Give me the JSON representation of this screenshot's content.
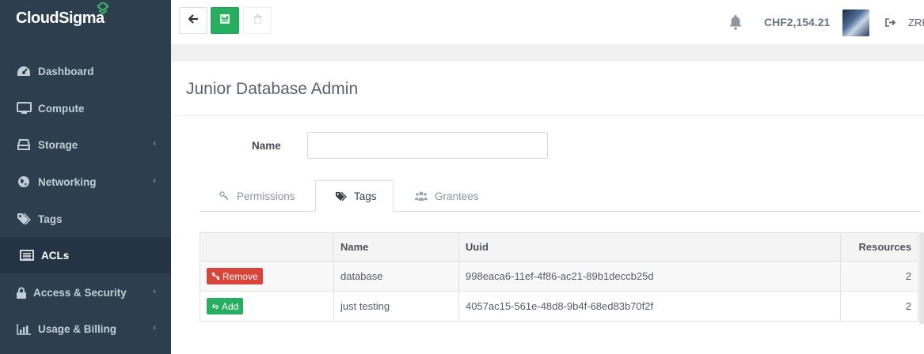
{
  "brand": {
    "name": "CloudSigma",
    "accent": "#27ae60",
    "sidebar_bg": "#2d3e4f"
  },
  "sidebar": {
    "items": [
      {
        "label": "Dashboard",
        "icon": "dashboard-icon",
        "has_submenu": false
      },
      {
        "label": "Compute",
        "icon": "monitor-icon",
        "has_submenu": false
      },
      {
        "label": "Storage",
        "icon": "hdd-icon",
        "has_submenu": true
      },
      {
        "label": "Networking",
        "icon": "globe-icon",
        "has_submenu": true
      },
      {
        "label": "Tags",
        "icon": "tags-icon",
        "has_submenu": false
      },
      {
        "label": "ACLs",
        "icon": "list-icon",
        "has_submenu": false,
        "active": true
      },
      {
        "label": "Access & Security",
        "icon": "lock-icon",
        "has_submenu": true
      },
      {
        "label": "Usage & Billing",
        "icon": "bar-chart-icon",
        "has_submenu": true
      }
    ]
  },
  "topbar": {
    "balance": "CHF2,154.21",
    "region": "ZRH",
    "icons": [
      "back-arrow-icon",
      "save-icon",
      "trash-icon",
      "bell-icon",
      "logout-icon"
    ]
  },
  "page": {
    "title": "Junior Database Admin",
    "name_label": "Name",
    "name_value": ""
  },
  "tabs": [
    {
      "label": "Permissions",
      "icon": "key-icon",
      "active": false
    },
    {
      "label": "Tags",
      "icon": "tags-icon",
      "active": true
    },
    {
      "label": "Grantees",
      "icon": "users-icon",
      "active": false
    }
  ],
  "table": {
    "headers": [
      "",
      "Name",
      "Uuid",
      "Resources"
    ],
    "rows": [
      {
        "action": "Remove",
        "action_type": "remove",
        "name": "database",
        "uuid": "998eaca6-11ef-4f86-ac21-89b1deccb25d",
        "resources": "2"
      },
      {
        "action": "Add",
        "action_type": "add",
        "name": "just testing",
        "uuid": "4057ac15-561e-48d8-9b4f-68ed83b70f2f",
        "resources": "2"
      }
    ]
  }
}
